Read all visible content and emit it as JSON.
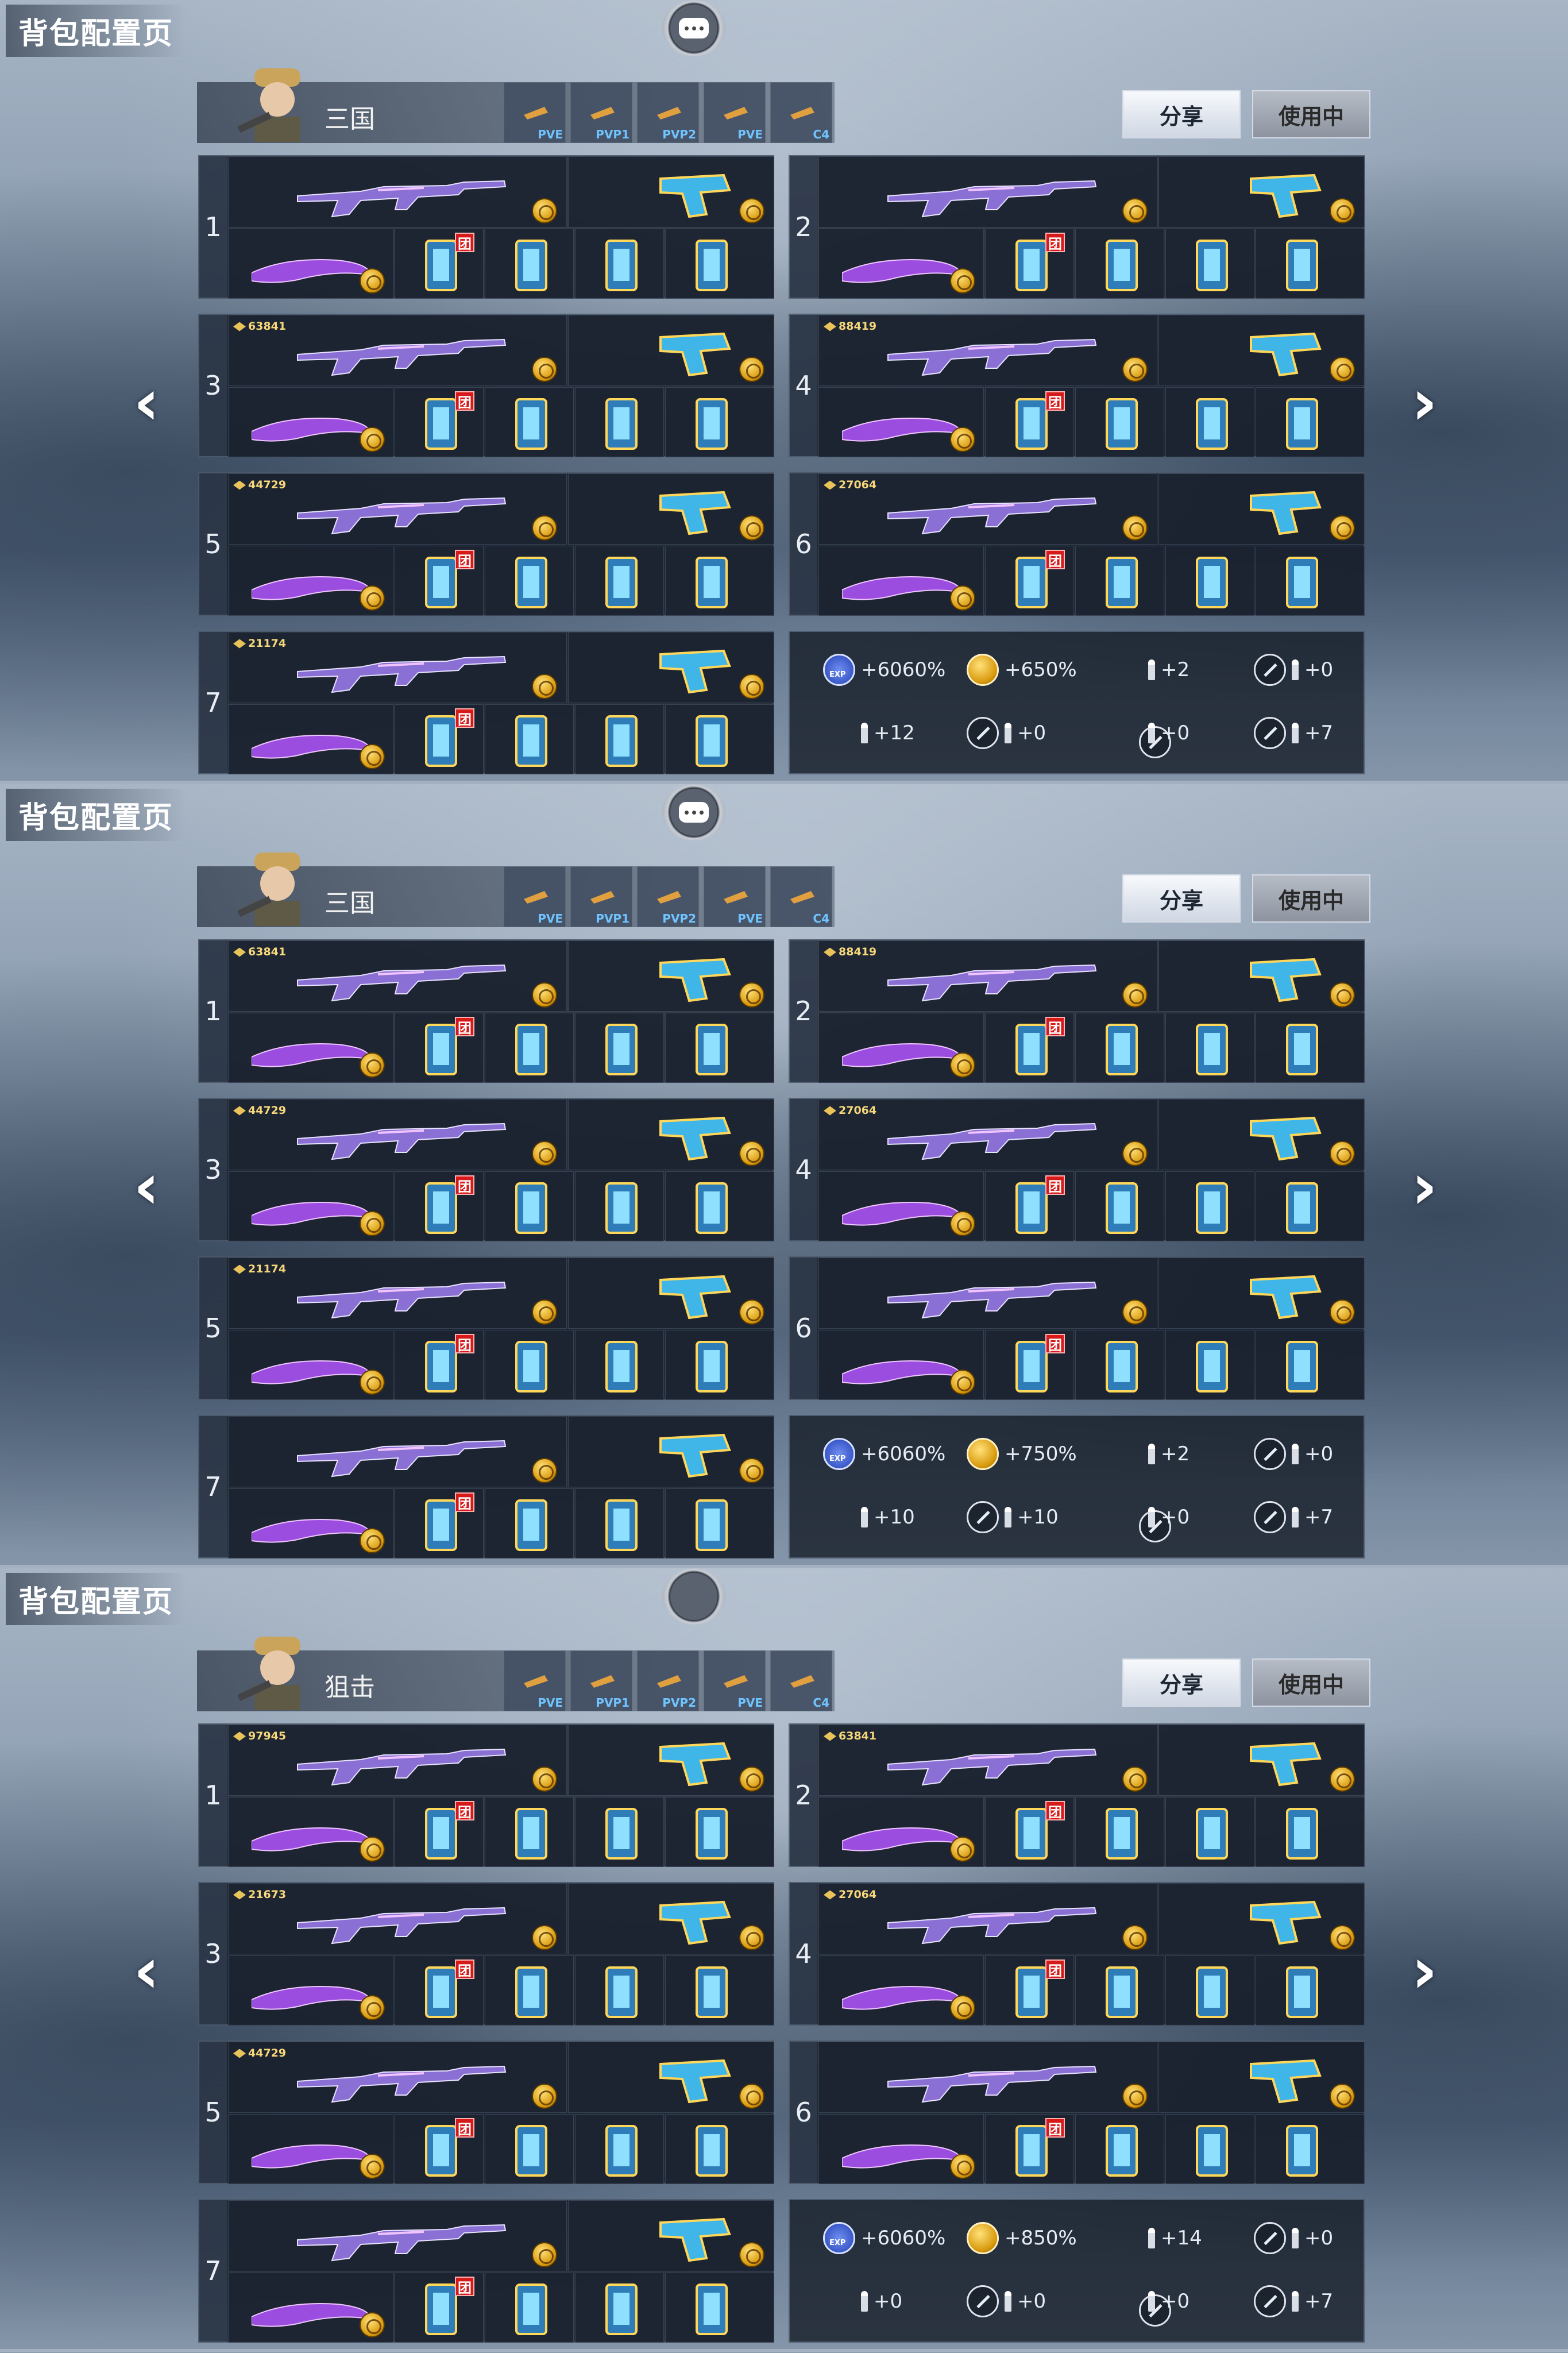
{
  "common": {
    "title": "背包配置页",
    "share_label": "分享",
    "inuse_label": "使用中",
    "mode_tabs": [
      "PVE",
      "PVP1",
      "PVP2",
      "PVE",
      "C4"
    ],
    "team_badge": "团",
    "arrow_left": "‹",
    "arrow_right": "›"
  },
  "sections": [
    {
      "profile_name": "三国",
      "chat_icon": "chat-bubble-icon",
      "loadouts": [
        {
          "num": "1",
          "kill_counter": ""
        },
        {
          "num": "2",
          "kill_counter": ""
        },
        {
          "num": "3",
          "kill_counter": "63841"
        },
        {
          "num": "4",
          "kill_counter": "88419"
        },
        {
          "num": "5",
          "kill_counter": "44729"
        },
        {
          "num": "6",
          "kill_counter": "27064"
        },
        {
          "num": "7",
          "kill_counter": "21174"
        }
      ],
      "stats": [
        "+6060%",
        "+650%",
        "+2",
        "+0",
        "+12",
        "+0",
        "+0",
        "+7"
      ]
    },
    {
      "profile_name": "三国",
      "chat_icon": "chat-bubble-icon",
      "loadouts": [
        {
          "num": "1",
          "kill_counter": "63841"
        },
        {
          "num": "2",
          "kill_counter": "88419"
        },
        {
          "num": "3",
          "kill_counter": "44729"
        },
        {
          "num": "4",
          "kill_counter": "27064"
        },
        {
          "num": "5",
          "kill_counter": "21174"
        },
        {
          "num": "6",
          "kill_counter": ""
        },
        {
          "num": "7",
          "kill_counter": ""
        }
      ],
      "stats": [
        "+6060%",
        "+750%",
        "+2",
        "+0",
        "+10",
        "+10",
        "+0",
        "+7"
      ]
    },
    {
      "profile_name": "狙击",
      "chat_icon": "chat-button-empty",
      "loadouts": [
        {
          "num": "1",
          "kill_counter": "97945"
        },
        {
          "num": "2",
          "kill_counter": "63841"
        },
        {
          "num": "3",
          "kill_counter": "21673"
        },
        {
          "num": "4",
          "kill_counter": "27064"
        },
        {
          "num": "5",
          "kill_counter": "44729"
        },
        {
          "num": "6",
          "kill_counter": ""
        },
        {
          "num": "7",
          "kill_counter": ""
        }
      ],
      "stats": [
        "+6060%",
        "+850%",
        "+14",
        "+0",
        "+0",
        "+0",
        "+0",
        "+7"
      ]
    }
  ],
  "colors": {
    "accent": "#f0c33b",
    "team": "#d61a1a",
    "panel": "#1c2431"
  }
}
